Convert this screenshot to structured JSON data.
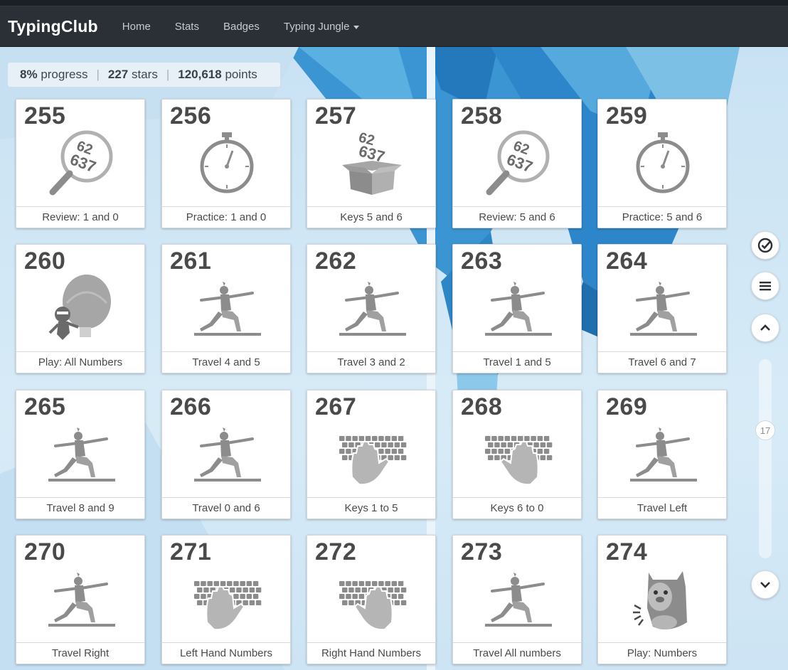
{
  "navbar": {
    "brand": "TypingClub",
    "links": [
      "Home",
      "Stats",
      "Badges",
      "Typing Jungle"
    ]
  },
  "progress": {
    "percent": "8%",
    "percent_label": "progress",
    "stars": "227",
    "stars_label": "stars",
    "points": "120,618",
    "points_label": "points"
  },
  "lessons": [
    {
      "number": "255",
      "title": "Review: 1 and 0",
      "icon": "magnifier-digits-icon"
    },
    {
      "number": "256",
      "title": "Practice: 1 and 0",
      "icon": "stopwatch-icon"
    },
    {
      "number": "257",
      "title": "Keys 5 and 6",
      "icon": "box-digits-icon"
    },
    {
      "number": "258",
      "title": "Review: 5 and 6",
      "icon": "magnifier-digits-icon"
    },
    {
      "number": "259",
      "title": "Practice: 5 and 6",
      "icon": "stopwatch-icon"
    },
    {
      "number": "260",
      "title": "Play: All Numbers",
      "icon": "balloon-ninja-icon"
    },
    {
      "number": "261",
      "title": "Travel 4 and 5",
      "icon": "lunge-figure-icon"
    },
    {
      "number": "262",
      "title": "Travel 3 and 2",
      "icon": "lunge-figure-icon"
    },
    {
      "number": "263",
      "title": "Travel 1 and 5",
      "icon": "lunge-figure-icon"
    },
    {
      "number": "264",
      "title": "Travel 6 and 7",
      "icon": "lunge-figure-icon"
    },
    {
      "number": "265",
      "title": "Travel 8 and 9",
      "icon": "lunge-figure-icon"
    },
    {
      "number": "266",
      "title": "Travel 0 and 6",
      "icon": "lunge-figure-icon"
    },
    {
      "number": "267",
      "title": "Keys 1 to 5",
      "icon": "keyboard-left-hand-icon"
    },
    {
      "number": "268",
      "title": "Keys 6 to 0",
      "icon": "keyboard-right-hand-icon"
    },
    {
      "number": "269",
      "title": "Travel Left",
      "icon": "lunge-figure-icon"
    },
    {
      "number": "270",
      "title": "Travel Right",
      "icon": "lunge-figure-icon"
    },
    {
      "number": "271",
      "title": "Left Hand Numbers",
      "icon": "keyboard-left-hand-icon"
    },
    {
      "number": "272",
      "title": "Right Hand Numbers",
      "icon": "keyboard-right-hand-icon"
    },
    {
      "number": "273",
      "title": "Travel All numbers",
      "icon": "lunge-figure-icon"
    },
    {
      "number": "274",
      "title": "Play: Numbers",
      "icon": "monster-icon"
    }
  ],
  "sidebar": {
    "scroll_level": "17",
    "buttons": [
      "check-circle-icon",
      "menu-icon",
      "chevron-up-icon",
      "chevron-down-icon"
    ]
  },
  "colors": {
    "navbar": "#2b3036",
    "icon_gray": "#8c8c8c",
    "page_bg": "#cfe6f4",
    "ice_blue": "#2f8fd0"
  }
}
